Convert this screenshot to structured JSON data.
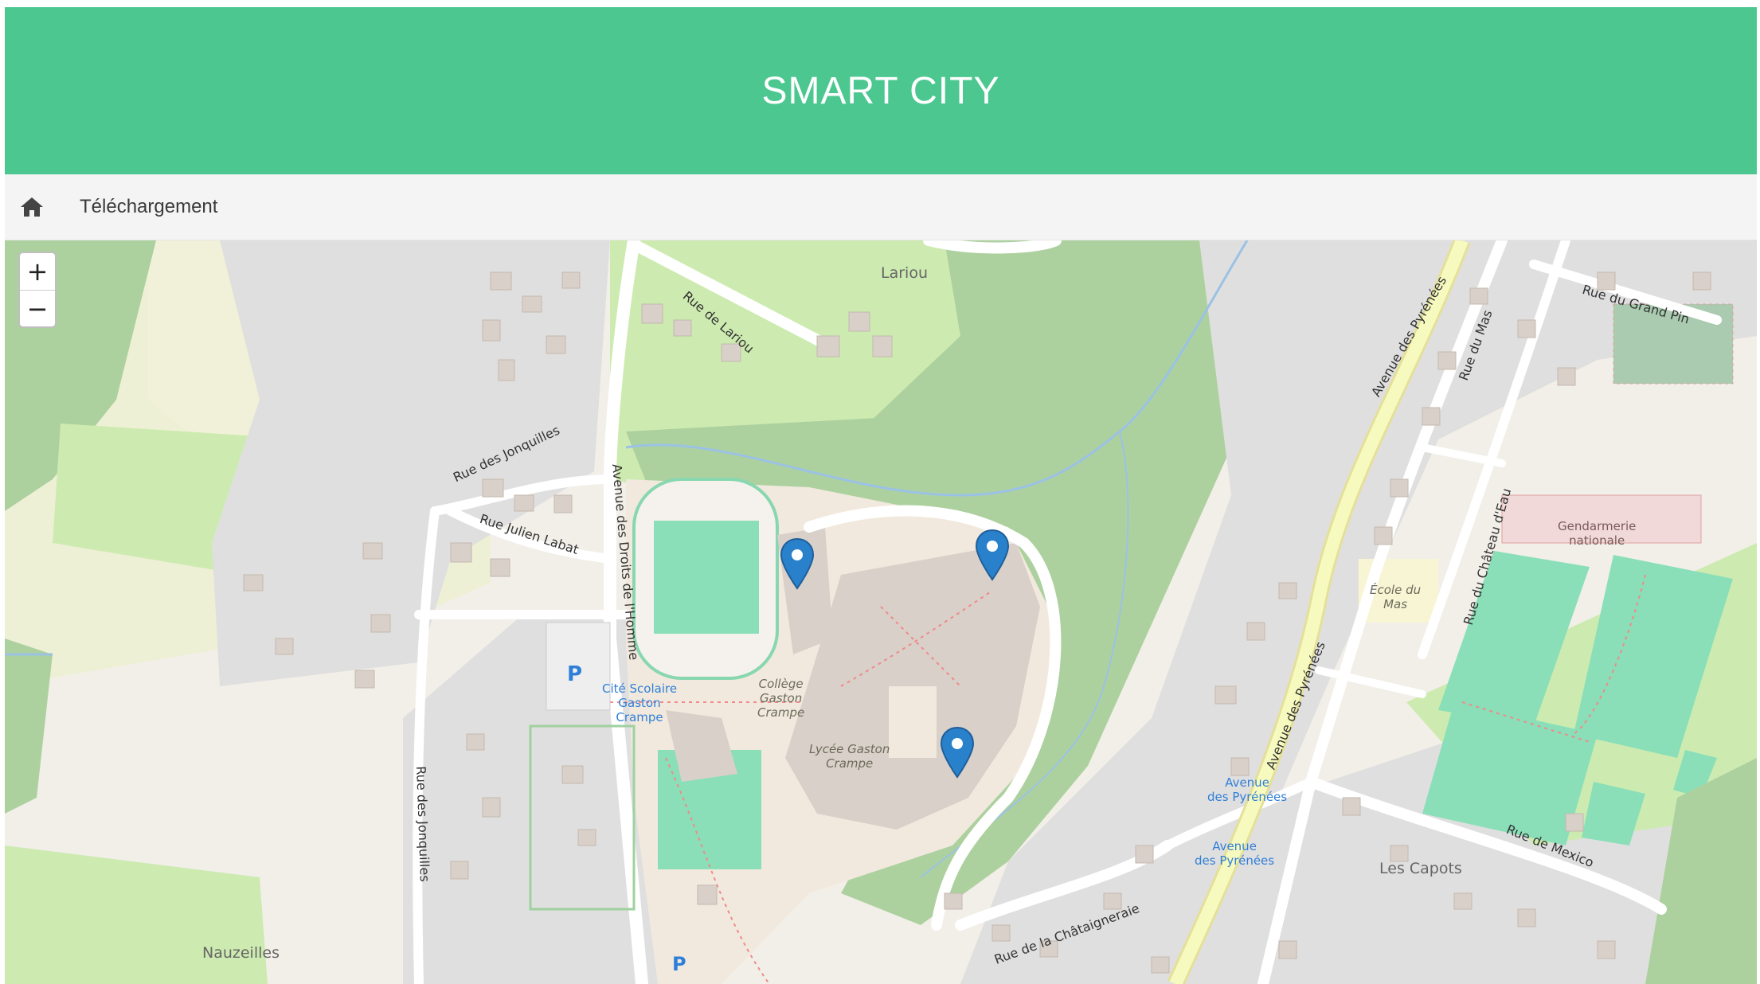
{
  "header": {
    "title": "SMART CITY"
  },
  "nav": {
    "home_icon": "home-icon",
    "link_label": "Téléchargement"
  },
  "map": {
    "zoom_in": "+",
    "zoom_out": "−",
    "markers": [
      "map-marker-icon",
      "map-marker-icon",
      "map-marker-icon"
    ],
    "labels": {
      "lariou": "Lariou",
      "rue_de_lariou": "Rue de Lariou",
      "rue_des_jonquilles_top": "Rue des Jonquilles",
      "rue_julien_labat": "Rue Julien Labat",
      "avenue_droits": "Avenue des Droits de l'Homme",
      "rue_des_jonquilles_left": "Rue des Jonquilles",
      "cite_scolaire_1": "Cité Scolaire",
      "cite_scolaire_2": "Gaston",
      "cite_scolaire_3": "Crampe",
      "college_1": "Collège",
      "college_2": "Gaston",
      "college_3": "Crampe",
      "lycee_1": "Lycée Gaston",
      "lycee_2": "Crampe",
      "nauzeilles": "Nauzeilles",
      "rue_chataigneraie": "Rue de la Châtaigneraie",
      "avenue_pyrenees_top": "Avenue des Pyrénées",
      "avenue_pyrenees_mid": "Avenue des Pyrénées",
      "bus_1a": "Avenue",
      "bus_1b": "des Pyrénées",
      "bus_2a": "Avenue",
      "bus_2b": "des Pyrénées",
      "rue_du_mas": "Rue du Mas",
      "rue_chateau_eau": "Rue du Château d'Eau",
      "rue_grand_pin": "Rue du Grand Pin",
      "gendarmerie_1": "Gendarmerie",
      "gendarmerie_2": "nationale",
      "ecole_1": "École du",
      "ecole_2": "Mas",
      "rue_mexico": "Rue de Mexico",
      "les_capots": "Les Capots",
      "parking": "P"
    }
  }
}
